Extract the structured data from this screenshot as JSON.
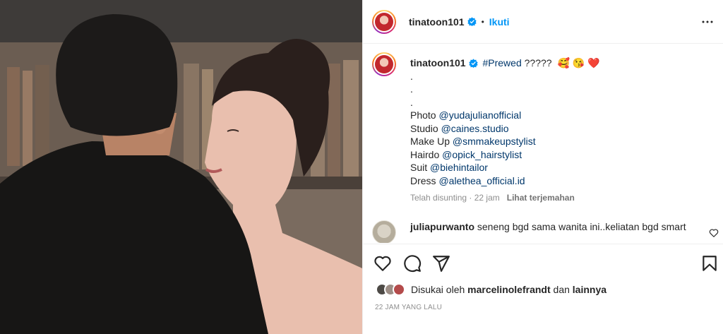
{
  "header": {
    "username": "tinatoon101",
    "dot": "•",
    "follow_label": "Ikuti"
  },
  "caption": {
    "username": "tinatoon101",
    "hashtag": "#Prewed",
    "text_after_hashtag": " ?????",
    "emoji": "🥰 😘 ❤️",
    "dots": [
      ".",
      ".",
      "."
    ],
    "credits": [
      {
        "label": "Photo",
        "handle": "@yudajulianofficial"
      },
      {
        "label": "Studio",
        "handle": "@caines.studio"
      },
      {
        "label": "Make Up",
        "handle": "@smmakeupstylist"
      },
      {
        "label": "Hairdo",
        "handle": "@opick_hairstylist"
      },
      {
        "label": "Suit",
        "handle": "@biehintailor"
      },
      {
        "label": "Dress",
        "handle": "@alethea_official.id"
      }
    ],
    "edited": "Telah disunting · 22 jam",
    "see_translation": "Lihat terjemahan"
  },
  "comment": {
    "username": "juliapurwanto",
    "text": "seneng bgd sama wanita ini..keliatan bgd smart"
  },
  "likes": {
    "prefix": "Disukai oleh",
    "user": "marcelinolefrandt",
    "middle": "dan",
    "suffix": "lainnya"
  },
  "timestamp": "22 JAM YANG LALU",
  "colors": {
    "accent": "#0095f6",
    "link": "#00376b",
    "muted": "#8e8e8e"
  },
  "icons": [
    "verified-badge-icon",
    "more-options-icon",
    "heart-icon",
    "comment-icon",
    "share-icon",
    "bookmark-icon"
  ]
}
